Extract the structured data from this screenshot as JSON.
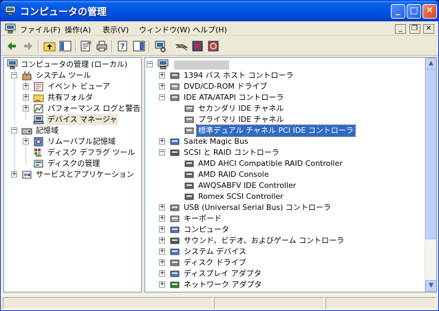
{
  "window": {
    "title": "コンピュータの管理",
    "buttons": {
      "minimize": "_",
      "maximize": "□",
      "close": "✕"
    }
  },
  "menubar": {
    "items": [
      "ファイル(F)",
      "操作(A)",
      "表示(V)",
      "ウィンドウ(W)",
      "ヘルプ(H)"
    ],
    "mdi": {
      "minimize": "_",
      "restore": "❐",
      "close": "✕"
    }
  },
  "toolbar": {
    "buttons": [
      "back-arrow-icon",
      "forward-arrow-icon",
      "up-folder-icon",
      "show-hide-tree-icon",
      "properties-icon",
      "print-icon",
      "help-icon",
      "console-tree-icon",
      "scan-hardware-icon",
      "update-driver-icon",
      "disable-device-icon",
      "uninstall-device-icon"
    ]
  },
  "left_tree": {
    "root": "コンピュータの管理 (ローカル)",
    "system_tools": "システム ツール",
    "event_viewer": "イベント ビューア",
    "shared_folders": "共有フォルダ",
    "performance_logs": "パフォーマンス ログと警告",
    "device_manager": "デバイス マネージャ",
    "storage": "記憶域",
    "removable_storage": "リムーバブル記憶域",
    "defrag": "ディスク デフラグ ツール",
    "disk_management": "ディスクの管理",
    "services_apps": "サービスとアプリケーション"
  },
  "right_tree": {
    "items": [
      {
        "label": "1394 バス ホスト コントローラ",
        "level": 1,
        "expander": "+"
      },
      {
        "label": "DVD/CD-ROM ドライブ",
        "level": 1,
        "expander": "+"
      },
      {
        "label": "IDE ATA/ATAPI コントローラ",
        "level": 1,
        "expander": "-"
      },
      {
        "label": "セカンダリ IDE チャネル",
        "level": 2,
        "expander": ""
      },
      {
        "label": "プライマリ IDE チャネル",
        "level": 2,
        "expander": ""
      },
      {
        "label": "標準デュアル チャネル PCI IDE コントローラ",
        "level": 2,
        "expander": "",
        "selected": true
      },
      {
        "label": "Saitek Magic Bus",
        "level": 1,
        "expander": "+"
      },
      {
        "label": "SCSI と RAID コントローラ",
        "level": 1,
        "expander": "-"
      },
      {
        "label": "AMD AHCI Compatible RAID Controller",
        "level": 2,
        "expander": ""
      },
      {
        "label": "AMD RAID Console",
        "level": 2,
        "expander": ""
      },
      {
        "label": "AWQSABFV IDE Controller",
        "level": 2,
        "expander": ""
      },
      {
        "label": "Romex SCSI Controller",
        "level": 2,
        "expander": ""
      },
      {
        "label": "USB (Universal Serial Bus) コントローラ",
        "level": 1,
        "expander": "+"
      },
      {
        "label": "キーボード",
        "level": 1,
        "expander": "+"
      },
      {
        "label": "コンピュータ",
        "level": 1,
        "expander": "+"
      },
      {
        "label": "サウンド、ビデオ、およびゲーム コントローラ",
        "level": 1,
        "expander": "+"
      },
      {
        "label": "システム デバイス",
        "level": 1,
        "expander": "+"
      },
      {
        "label": "ディスク ドライブ",
        "level": 1,
        "expander": "+"
      },
      {
        "label": "ディスプレイ アダプタ",
        "level": 1,
        "expander": "+"
      },
      {
        "label": "ネットワーク アダプタ",
        "level": 1,
        "expander": "+"
      }
    ]
  },
  "scrollbar": {
    "up": "▲",
    "down": "▼"
  }
}
